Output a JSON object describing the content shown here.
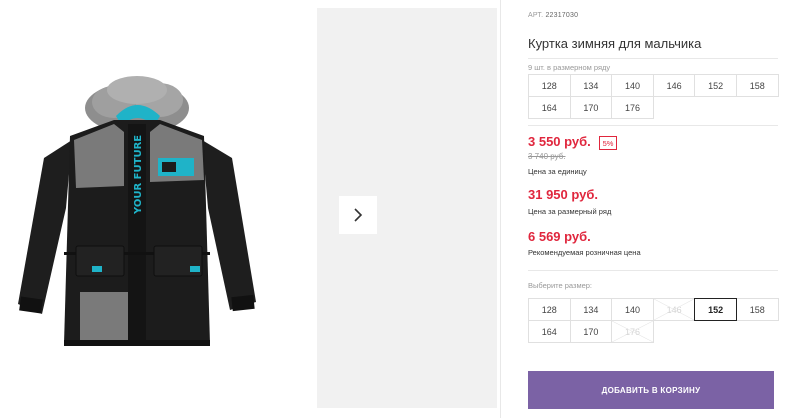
{
  "product": {
    "article_label": "АРТ.",
    "article_number": "22317030",
    "title": "Куртка зимняя для мальчика",
    "jacket_print": "YOUR FUTURE"
  },
  "size_range": {
    "caption": "9 шт. в размерном ряду",
    "sizes": [
      "128",
      "134",
      "140",
      "146",
      "152",
      "158",
      "164",
      "170",
      "176"
    ]
  },
  "pricing": {
    "unit_price": "3 550 руб.",
    "discount_badge": "5%",
    "old_price": "3 740 руб.",
    "unit_caption": "Цена за единицу",
    "range_price": "31 950 руб.",
    "range_caption": "Цена за размерный ряд",
    "retail_price": "6 569 руб.",
    "retail_caption": "Рекомендуемая розничная цена"
  },
  "size_select": {
    "caption": "Выберите размер:",
    "options": [
      {
        "label": "128",
        "state": "available"
      },
      {
        "label": "134",
        "state": "available"
      },
      {
        "label": "140",
        "state": "available"
      },
      {
        "label": "146",
        "state": "disabled"
      },
      {
        "label": "152",
        "state": "selected"
      },
      {
        "label": "158",
        "state": "available"
      },
      {
        "label": "164",
        "state": "available"
      },
      {
        "label": "170",
        "state": "available"
      },
      {
        "label": "176",
        "state": "disabled"
      }
    ]
  },
  "cart": {
    "button_label": "ДОБАВИТЬ В КОРЗИНУ"
  },
  "icons": {
    "next": "chevron-right-icon"
  },
  "colors": {
    "price": "#e0263d",
    "button": "#7b62a5",
    "jacket_accent": "#1fb3c8"
  }
}
